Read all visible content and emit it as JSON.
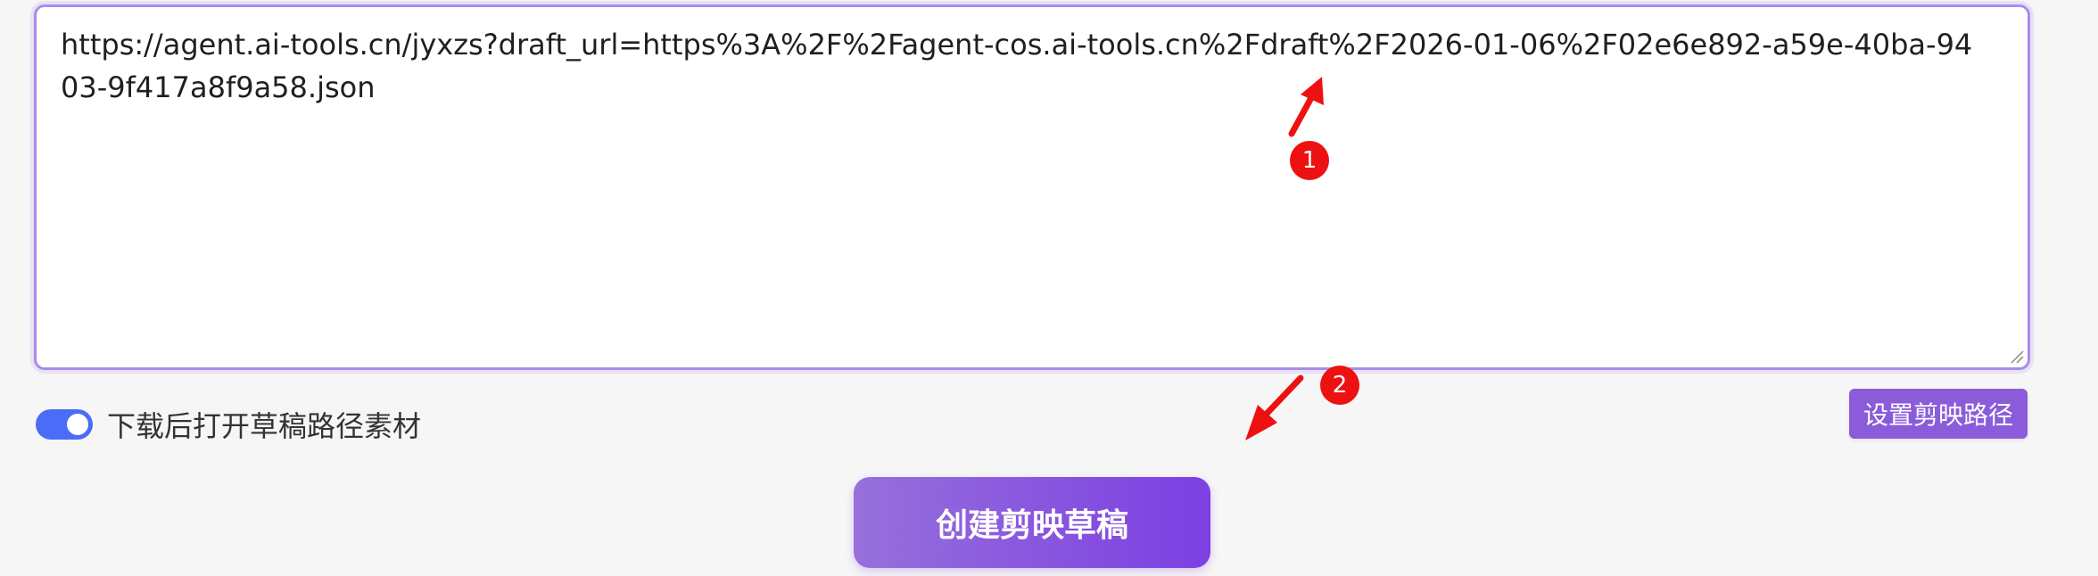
{
  "url_input": {
    "value": "https://agent.ai-tools.cn/jyxzs?draft_url=https%3A%2F%2Fagent-cos.ai-tools.cn%2Fdraft%2F2026-01-06%2F02e6e892-a59e-40ba-9403-9f417a8f9a58.json"
  },
  "toggle": {
    "label": "下载后打开草稿路径素材",
    "on": true
  },
  "buttons": {
    "set_path": "设置剪映路径",
    "create_draft": "创建剪映草稿"
  },
  "annotations": {
    "badge_1": "1",
    "badge_2": "2"
  },
  "colors": {
    "accent": "#8a5cd9",
    "toggle_on": "#4a6cf7",
    "annotation": "#ee1111",
    "border": "#a98bec"
  }
}
